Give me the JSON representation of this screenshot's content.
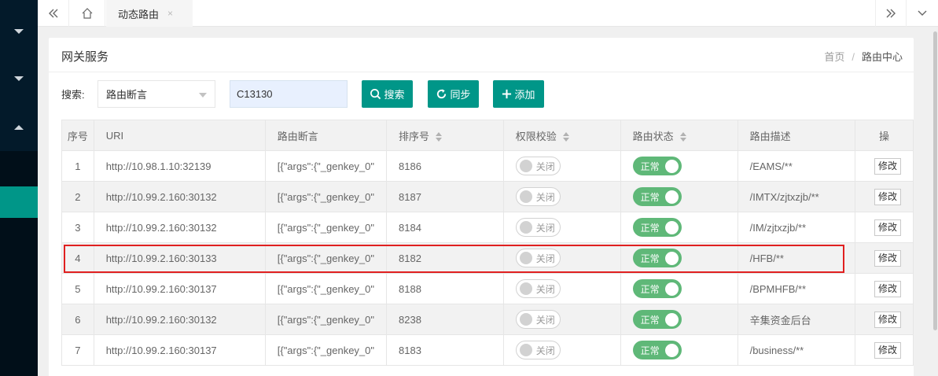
{
  "tabs": {
    "active_label": "动态路由",
    "close_glyph": "×"
  },
  "page": {
    "title": "网关服务",
    "breadcrumb": [
      "首页",
      "路由中心"
    ],
    "breadcrumb_sep": "/"
  },
  "search": {
    "label": "搜索:",
    "select_value": "路由断言",
    "input_value": "C13130"
  },
  "buttons": {
    "search": "搜索",
    "sync": "同步",
    "add": "添加"
  },
  "table": {
    "columns": [
      "序号",
      "URI",
      "路由断言",
      "排序号",
      "权限校验",
      "路由状态",
      "路由描述",
      "操"
    ],
    "rows": [
      {
        "index": "1",
        "uri": "http://10.98.1.10:32139",
        "predicate": "[{\"args\":{\"_genkey_0\"",
        "order": "8186",
        "auth": "关闭",
        "status": "正常",
        "desc": "/EAMS/**",
        "action": "修改"
      },
      {
        "index": "2",
        "uri": "http://10.99.2.160:30132",
        "predicate": "[{\"args\":{\"_genkey_0\"",
        "order": "8187",
        "auth": "关闭",
        "status": "正常",
        "desc": "/IMTX/zjtxzjb/**",
        "action": "修改"
      },
      {
        "index": "3",
        "uri": "http://10.99.2.160:30132",
        "predicate": "[{\"args\":{\"_genkey_0\"",
        "order": "8184",
        "auth": "关闭",
        "status": "正常",
        "desc": "/IM/zjtxzjb/**",
        "action": "修改"
      },
      {
        "index": "4",
        "uri": "http://10.99.2.160:30133",
        "predicate": "[{\"args\":{\"_genkey_0\"",
        "order": "8182",
        "auth": "关闭",
        "status": "正常",
        "desc": "/HFB/**",
        "action": "修改"
      },
      {
        "index": "5",
        "uri": "http://10.99.2.160:30137",
        "predicate": "[{\"args\":{\"_genkey_0\"",
        "order": "8188",
        "auth": "关闭",
        "status": "正常",
        "desc": "/BPMHFB/**",
        "action": "修改"
      },
      {
        "index": "6",
        "uri": "http://10.99.2.160:30132",
        "predicate": "[{\"args\":{\"_genkey_0\"",
        "order": "8238",
        "auth": "关闭",
        "status": "正常",
        "desc": "辛集资金后台",
        "action": "修改"
      },
      {
        "index": "7",
        "uri": "http://10.99.2.160:30137",
        "predicate": "[{\"args\":{\"_genkey_0\"",
        "order": "8183",
        "auth": "关闭",
        "status": "正常",
        "desc": "/business/**",
        "action": "修改"
      }
    ]
  },
  "colors": {
    "accent": "#009688",
    "switch_on": "#5fb878",
    "sidebar_bg": "#031a2a",
    "highlight": "#e02020"
  }
}
